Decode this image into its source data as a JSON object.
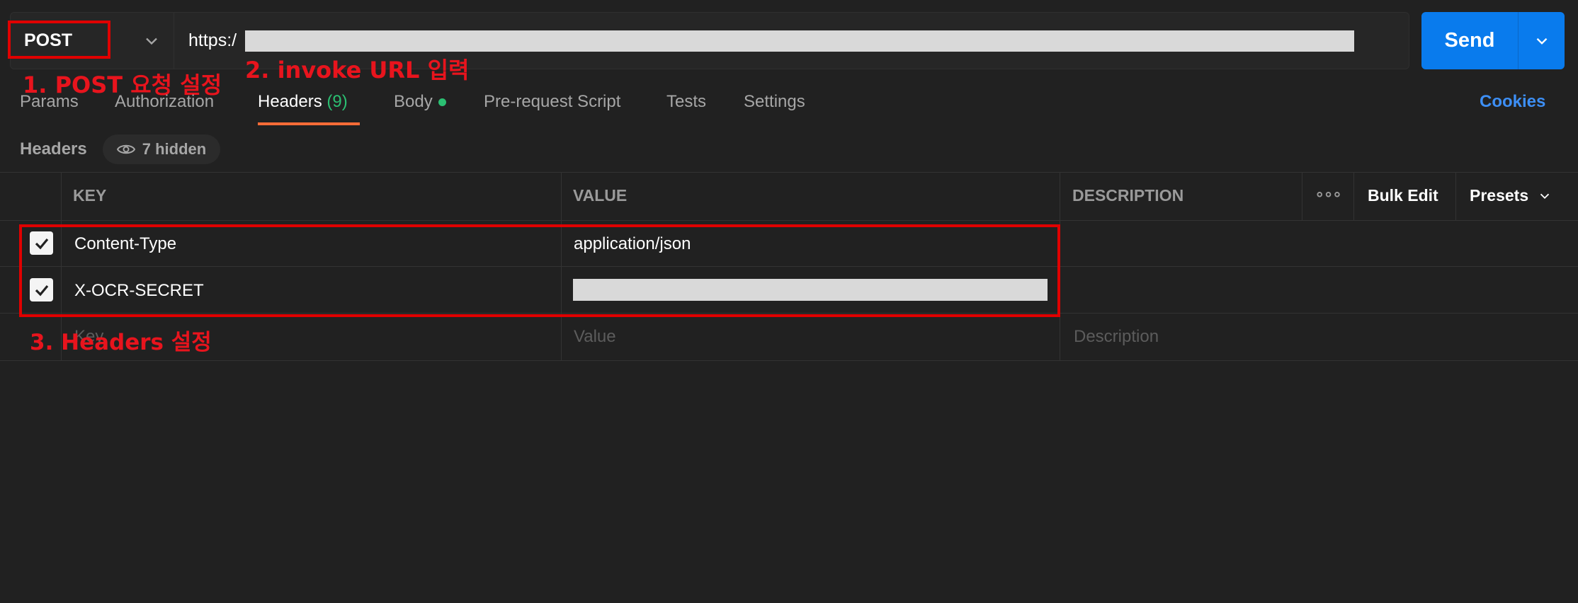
{
  "request": {
    "method": "POST",
    "url_prefix": "https:/",
    "send_label": "Send"
  },
  "annotations": {
    "step1": "1. POST 요청 설정",
    "step2": "2. invoke URL 입력",
    "step3": "3. Headers 설정"
  },
  "tabs": [
    {
      "label": "Params"
    },
    {
      "label": "Authorization"
    },
    {
      "label": "Headers",
      "count": "(9)",
      "active": true
    },
    {
      "label": "Body"
    },
    {
      "label": "Pre-request Script"
    },
    {
      "label": "Tests"
    },
    {
      "label": "Settings"
    }
  ],
  "cookies_label": "Cookies",
  "headers_section": {
    "title": "Headers",
    "hidden_label": "7 hidden"
  },
  "table": {
    "columns": {
      "key": "KEY",
      "value": "VALUE",
      "description": "DESCRIPTION",
      "more": "∘∘∘",
      "bulk_edit": "Bulk Edit",
      "presets": "Presets"
    },
    "rows": [
      {
        "key": "Content-Type",
        "value": "application/json",
        "checked": true
      },
      {
        "key": "X-OCR-SECRET",
        "value": "",
        "checked": true
      }
    ],
    "placeholders": {
      "key": "Key",
      "value": "Value",
      "description": "Description"
    }
  },
  "colors": {
    "background": "#212121",
    "send": "#097bed",
    "active_tab_underline": "#ff6c37",
    "annotation": "#e8141d",
    "cookies_link": "#3d8ff5"
  }
}
